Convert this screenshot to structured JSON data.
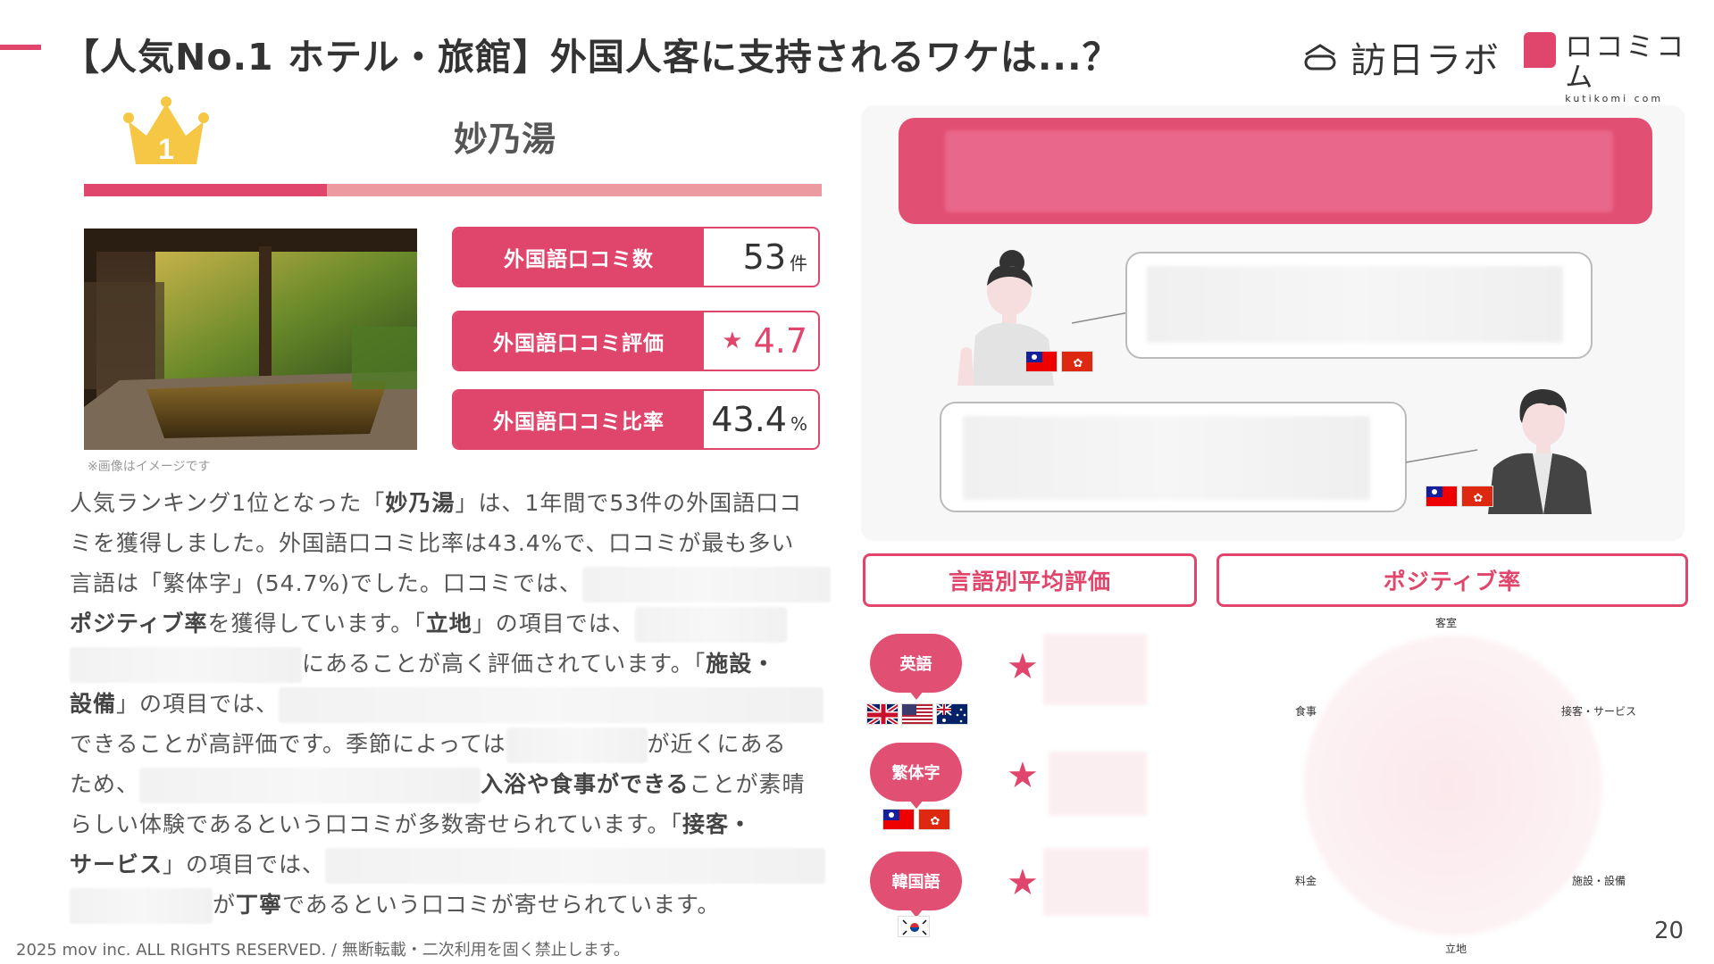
{
  "header": {
    "title": "【人気No.1 ホテル・旅館】外国人客に支持されるワケは...？",
    "logo_houjin_text": "訪日ラボ",
    "logo_kutikomi_text": "ロコミコム",
    "logo_kutikomi_sub": "kutikomi com"
  },
  "ranking": {
    "rank": "1",
    "hotel_name": "妙乃湯",
    "photo_caption": "※画像はイメージです"
  },
  "stats": [
    {
      "label": "外国語口コミ数",
      "value": "53",
      "unit": "件"
    },
    {
      "label": "外国語口コミ評価",
      "value": "4.7",
      "star": "★"
    },
    {
      "label": "外国語口コミ比率",
      "value": "43.4",
      "unit": "%"
    }
  ],
  "body": {
    "l1": "人気ランキング1位となった「",
    "l1b": "妙乃湯",
    "l1c": "」は、1年間で53件の外国語口コ",
    "l2": "ミを獲得しました。外国語口コミ比率は43.4%で、口コミが最も多い",
    "l3": "言語は「繁体字」(54.7%)でした。口コミでは、",
    "l4b": "ポジティブ率",
    "l4": "を獲得しています。「",
    "l4c": "立地",
    "l4d": "」の項目では、",
    "l5": "にあることが高く評価されています。「",
    "l5b": "施設・",
    "l6b": "設備",
    "l6": "」の項目では、",
    "l7a": "できることが高評価です。季節によっては",
    "l7b": "が近くにある",
    "l8a": "ため、",
    "l8b": "入浴や食事ができる",
    "l8c": "ことが素晴",
    "l9": "らしい体験であるという口コミが多数寄せられています。「",
    "l9b": "接客・",
    "l10b": "サービス",
    "l10": "」の項目では、",
    "l11a": "が",
    "l11b": "丁寧",
    "l11c": "であるという口コミが寄せられています。"
  },
  "footer": {
    "copyright": "2025 mov inc. ALL RIGHTS RESERVED. / 無断転載・二次利用を固く禁止します。",
    "page_number": "20"
  },
  "right_panel": {
    "section_language": "言語別平均評価",
    "section_positive": "ポジティブ率",
    "languages": [
      {
        "name": "英語",
        "flags": [
          "uk",
          "us",
          "au"
        ]
      },
      {
        "name": "繁体字",
        "flags": [
          "tw",
          "hk"
        ]
      },
      {
        "name": "韓国語",
        "flags": [
          "kr"
        ]
      }
    ],
    "radar_axes": [
      "客室",
      "接客・サービス",
      "施設・設備",
      "立地",
      "料金",
      "食事"
    ]
  },
  "colors": {
    "accent": "#e0466b",
    "accent_light": "#ec9a9f",
    "crown": "#f6c744"
  }
}
